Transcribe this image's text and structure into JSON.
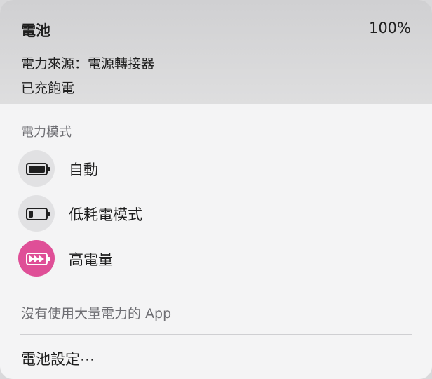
{
  "header": {
    "title": "電池",
    "percent": "100%",
    "power_source": "電力來源：電源轉接器",
    "status": "已充飽電"
  },
  "energy_mode": {
    "section_label": "電力模式",
    "modes": [
      {
        "label": "自動",
        "icon": "battery-full-icon",
        "selected": false
      },
      {
        "label": "低耗電模式",
        "icon": "battery-low-icon",
        "selected": false
      },
      {
        "label": "高電量",
        "icon": "battery-high-power-icon",
        "selected": true
      }
    ],
    "accent_color": "#df4f97"
  },
  "apps": {
    "empty_text": "沒有使用大量電力的 App"
  },
  "footer": {
    "settings_label": "電池設定⋯"
  }
}
